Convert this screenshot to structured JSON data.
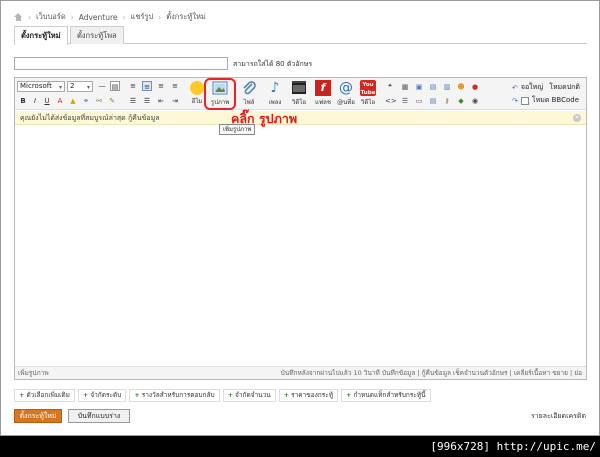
{
  "breadcrumb": {
    "items": [
      "เว็บบอร์ด",
      "Adventure",
      "แชร์รูป",
      "ตั้งกระทู้ใหม่"
    ]
  },
  "tabs": [
    {
      "label": "ตั้งกระทู้ใหม่"
    },
    {
      "label": "ตั้งกระทู้โพล"
    }
  ],
  "title_field": {
    "value": "",
    "hint": "สามารถใส่ได้ 80 ตัวอักษร"
  },
  "toolbar": {
    "font_select": "Microsoft",
    "size_select": "2",
    "big_buttons": [
      {
        "label": "อีโม",
        "icon": "emoticon-icon"
      },
      {
        "label": "รูปภาพ",
        "icon": "image-icon"
      },
      {
        "label": "ไฟล์",
        "icon": "attachment-icon"
      },
      {
        "label": "เพลง",
        "icon": "music-icon"
      },
      {
        "label": "วิดีโอ",
        "icon": "video-icon"
      },
      {
        "label": "แฟลช",
        "icon": "flash-icon"
      },
      {
        "label": "@นที่อ",
        "icon": "mention-icon"
      },
      {
        "label": "วิดีโอ",
        "icon": "youtube-icon"
      }
    ],
    "undo_label": "จอใหญ่",
    "full_mode_label": "โหมดปกติ",
    "bbcode_label": "โหมด BBCode"
  },
  "notice": {
    "text": "คุณยังไม่ได้ส่งข้อมูลที่สมบูรณ์ล่าสุด กู้คืนข้อมูล"
  },
  "tooltip": {
    "text": "เพิ่มรูปภาพ"
  },
  "annotation": {
    "text": "คลิ๊ก   รูปภาพ"
  },
  "statusbar": {
    "left": "เพิ่มรูปภาพ",
    "right": "บันทึกหลังจากผ่านไปแล้ว 10 วินาที บันทึกข้อมูล | กู้คืนข้อมูล     เช็คจำนวนตัวอักษร | เคลียร์เนื้อหา     ขยาย | ย่อ"
  },
  "prefix_buttons": [
    "ตัวเลือกเพิ่มเติม",
    "จำกัดระดับ",
    "รางวัลสำหรับการตอบกลับ",
    "จำกัดจำนวน",
    "ราคาของกระทู้",
    "กำหนดแท็กสำหรับกระทู้นี้"
  ],
  "actions": {
    "post": "ตั้งกระทู้ใหม่",
    "draft": "บันทึกแบบร่าง",
    "more": "รายละเอียดเครดิต"
  },
  "watermark": "[996x728] http://upic.me/",
  "colors": {
    "accent": "#d87620",
    "annotation": "#e01c1c",
    "notice_bg": "#fdf8d6"
  }
}
